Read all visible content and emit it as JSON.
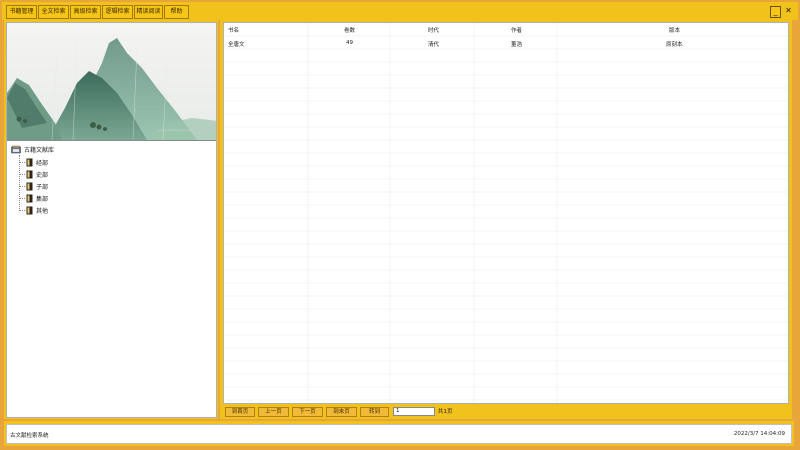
{
  "menu": {
    "items": [
      {
        "label": "书籍管理"
      },
      {
        "label": "全文检索"
      },
      {
        "label": "高级检索"
      },
      {
        "label": "逻辑检索"
      },
      {
        "label": "精读阅读"
      },
      {
        "label": "帮助"
      }
    ],
    "minimize": "_",
    "close": "✕"
  },
  "tree": {
    "root": {
      "label": "古籍文献库",
      "icon": "library-icon"
    },
    "items": [
      {
        "label": "经部",
        "icon": "book-icon"
      },
      {
        "label": "史部",
        "icon": "book-icon"
      },
      {
        "label": "子部",
        "icon": "book-icon"
      },
      {
        "label": "集部",
        "icon": "book-icon"
      },
      {
        "label": "其他",
        "icon": "book-icon"
      }
    ]
  },
  "table": {
    "columns": [
      "书名",
      "卷数",
      "时代",
      "作者",
      "版本"
    ],
    "rows": [
      [
        "全唐文",
        "49",
        "清代",
        "董浩",
        "原刻本"
      ]
    ]
  },
  "pager": {
    "first": "到首页",
    "prev": "上一页",
    "next": "下一页",
    "last": "到末页",
    "goto": "转到",
    "page_value": "1",
    "total_text": "共1页"
  },
  "status": {
    "app_name": "古文献检索系统",
    "datetime": "2022/3/7  14:04:09"
  },
  "colors": {
    "frame": "#f2c21c",
    "background": "#e8a53a",
    "button": "#f0b938"
  }
}
